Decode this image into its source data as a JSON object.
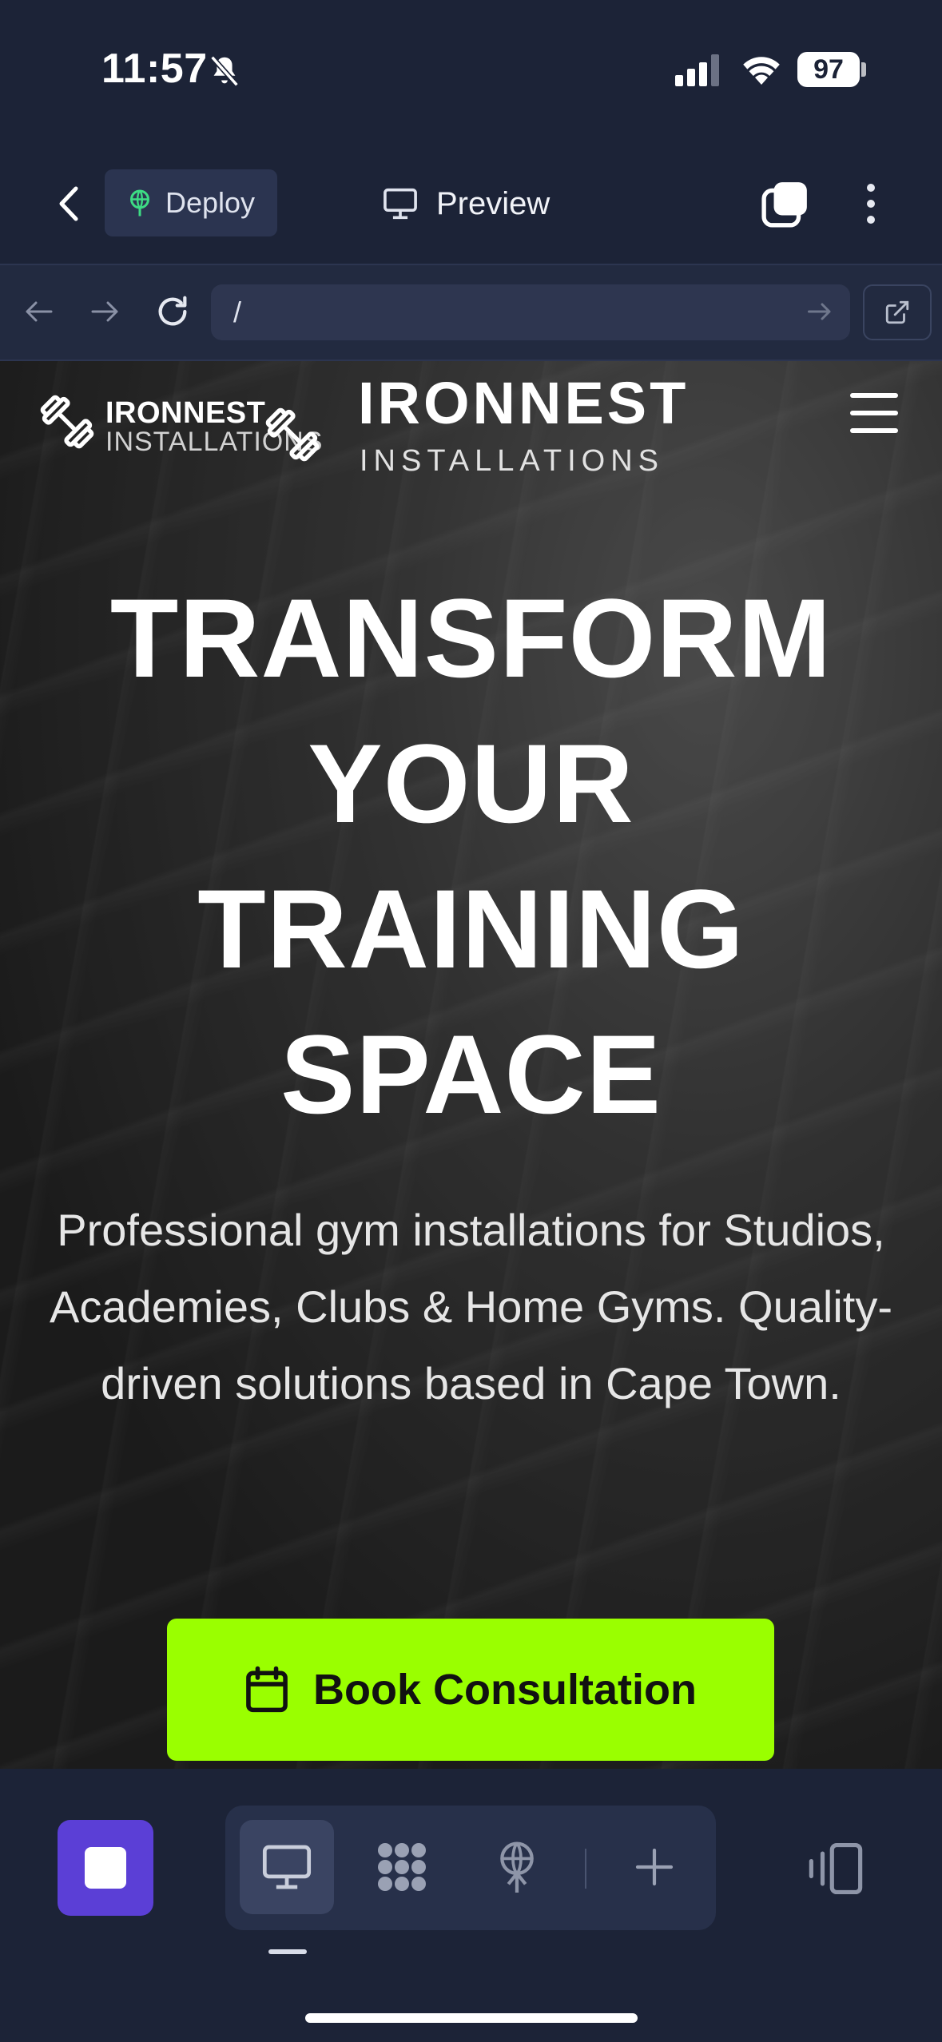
{
  "status_bar": {
    "time": "11:57",
    "battery": "97"
  },
  "toolbar": {
    "deploy_label": "Deploy",
    "preview_label": "Preview"
  },
  "browser": {
    "url": "/"
  },
  "site": {
    "logo_line1": "IRONNEST",
    "logo_line2": "INSTALLATIONS",
    "brand_title": "IRONNEST",
    "brand_subtitle": "INSTALLATIONS",
    "hero_lines": [
      "TRANSFORM",
      "YOUR",
      "TRAINING",
      "SPACE"
    ],
    "hero_paragraph": "Professional gym installations for Studios, Academies, Clubs & Home Gyms. Quality-driven solutions based in Cape Town.",
    "cta_label": "Book Consultation",
    "accent_color": "#9aff00"
  },
  "dock": {
    "tools": [
      "desktop-icon",
      "apps-icon",
      "deploy-icon",
      "plus-icon"
    ],
    "accent_color": "#5b3fd6"
  }
}
